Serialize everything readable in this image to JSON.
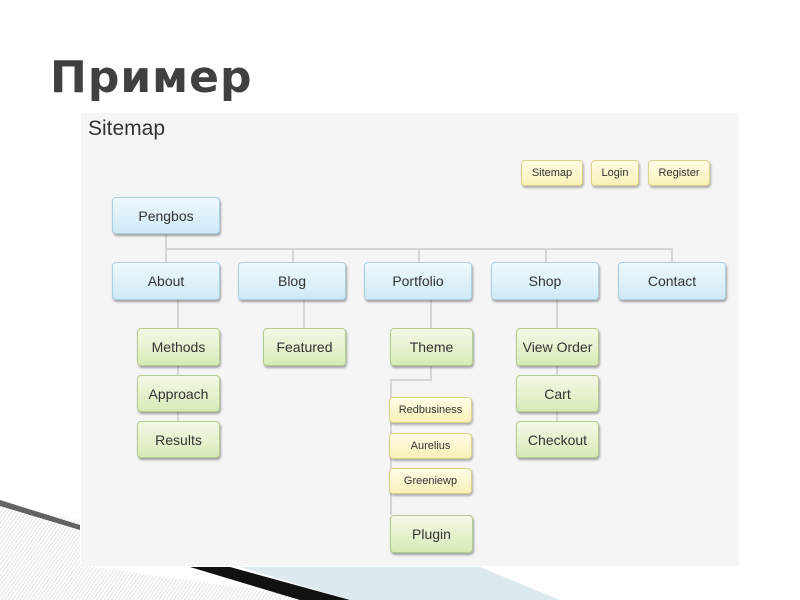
{
  "slide": {
    "title": "Пример"
  },
  "sitemap": {
    "title": "Sitemap",
    "utility_nav": [
      "Sitemap",
      "Login",
      "Register"
    ],
    "root": "Pengbos",
    "sections": [
      {
        "label": "About",
        "children": [
          "Methods",
          "Approach",
          "Results"
        ]
      },
      {
        "label": "Blog",
        "children": [
          "Featured"
        ]
      },
      {
        "label": "Portfolio",
        "children": [
          "Theme",
          "Plugin"
        ],
        "theme_children": [
          "Redbusiness",
          "Aurelius",
          "Greeniewp"
        ]
      },
      {
        "label": "Shop",
        "children": [
          "View Order",
          "Cart",
          "Checkout"
        ]
      },
      {
        "label": "Contact",
        "children": []
      }
    ]
  },
  "colors": {
    "section_fill": "#d9eff8",
    "child_fill": "#e3f0c8",
    "utility_fill": "#fbf4c8",
    "title_text": "#404040"
  }
}
